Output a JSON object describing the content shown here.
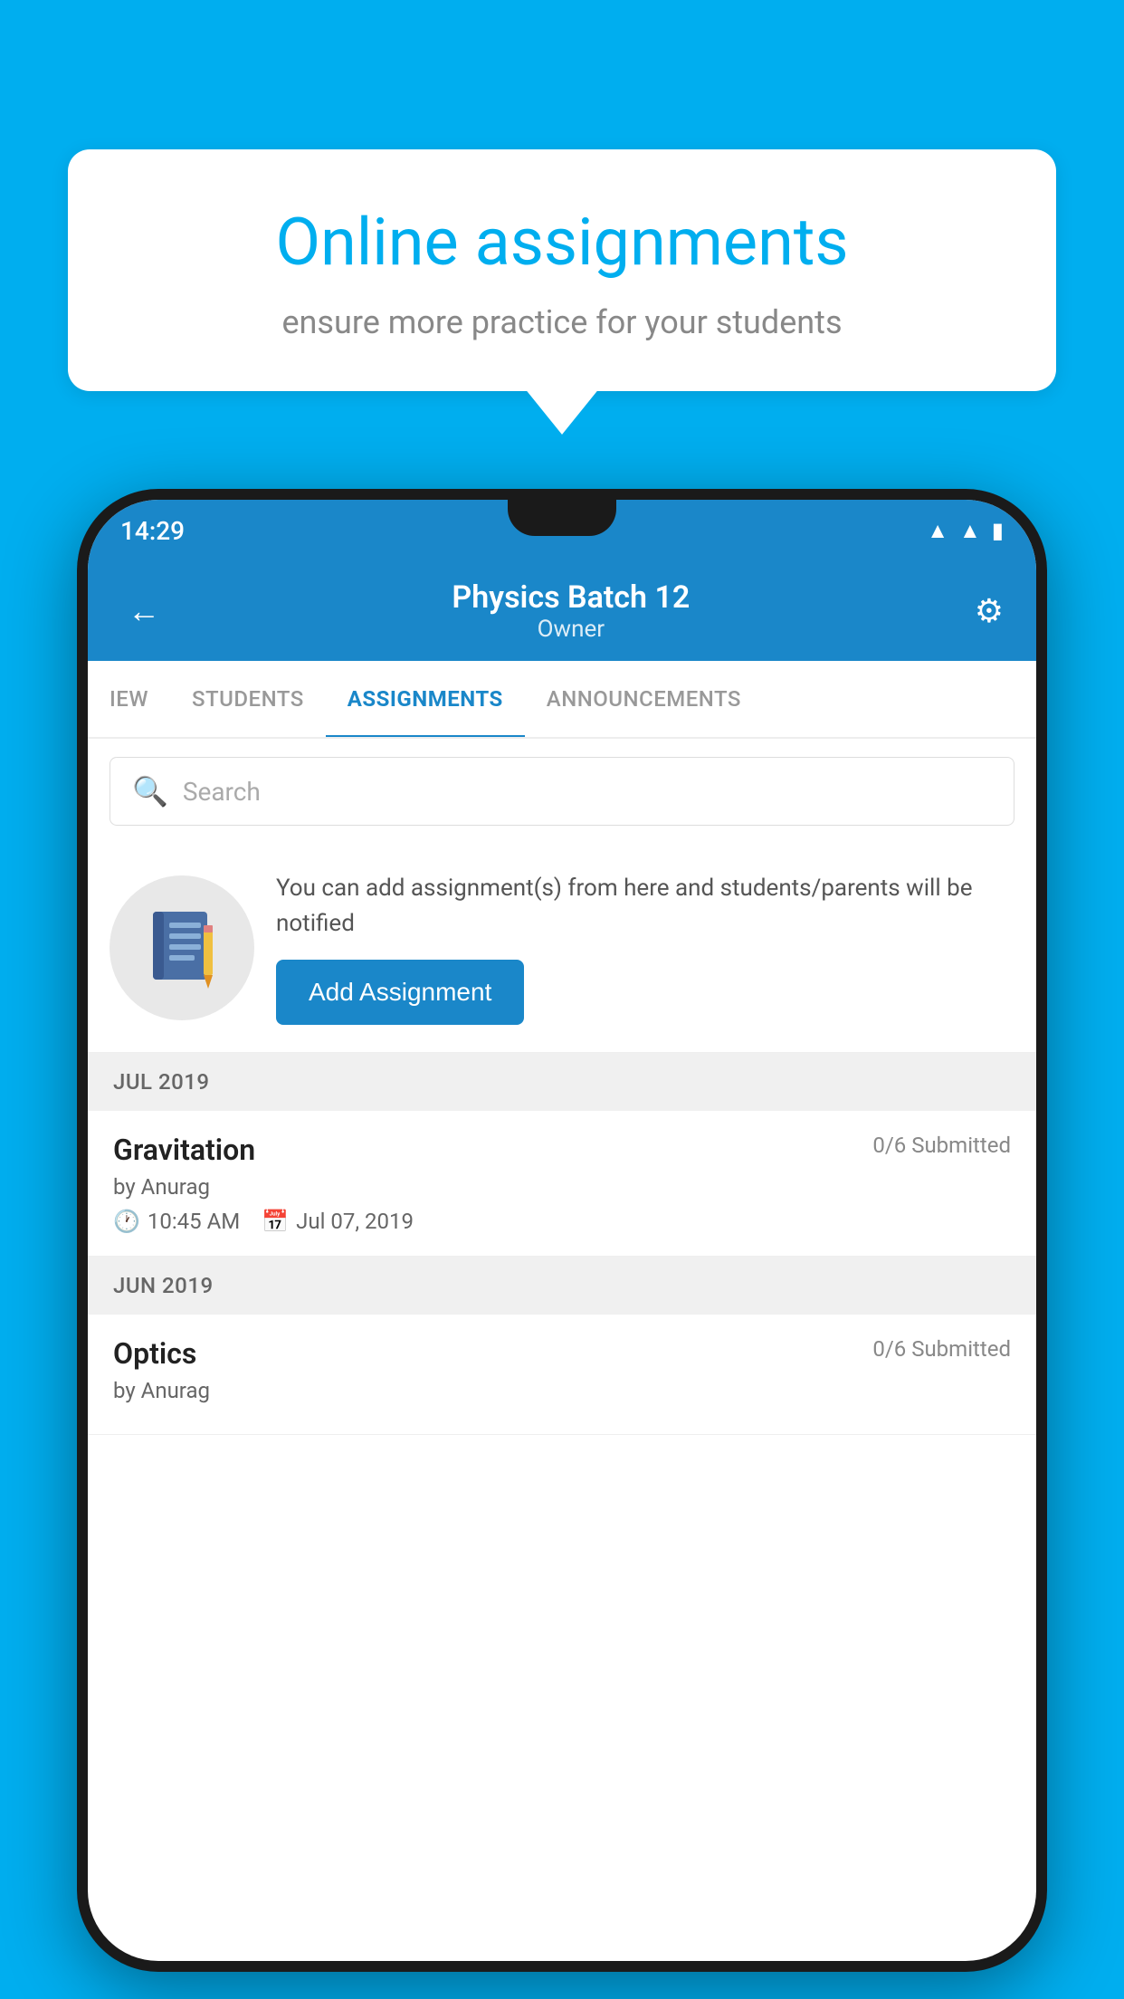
{
  "background": {
    "color": "#00AEEF"
  },
  "speech_bubble": {
    "title": "Online assignments",
    "subtitle": "ensure more practice for your students"
  },
  "status_bar": {
    "time": "14:29",
    "wifi_icon": "▼",
    "signal_icon": "▲",
    "battery_icon": "▮"
  },
  "header": {
    "title": "Physics Batch 12",
    "subtitle": "Owner",
    "back_label": "←",
    "gear_label": "⚙"
  },
  "tabs": [
    {
      "label": "IEW",
      "active": false
    },
    {
      "label": "STUDENTS",
      "active": false
    },
    {
      "label": "ASSIGNMENTS",
      "active": true
    },
    {
      "label": "ANNOUNCEMENTS",
      "active": false
    }
  ],
  "search": {
    "placeholder": "Search"
  },
  "promo": {
    "text": "You can add assignment(s) from here and students/parents will be notified",
    "button_label": "Add Assignment"
  },
  "sections": [
    {
      "label": "JUL 2019",
      "assignments": [
        {
          "title": "Gravitation",
          "submitted": "0/6 Submitted",
          "author": "by Anurag",
          "time": "10:45 AM",
          "date": "Jul 07, 2019"
        }
      ]
    },
    {
      "label": "JUN 2019",
      "assignments": [
        {
          "title": "Optics",
          "submitted": "0/6 Submitted",
          "author": "by Anurag",
          "time": "",
          "date": ""
        }
      ]
    }
  ]
}
